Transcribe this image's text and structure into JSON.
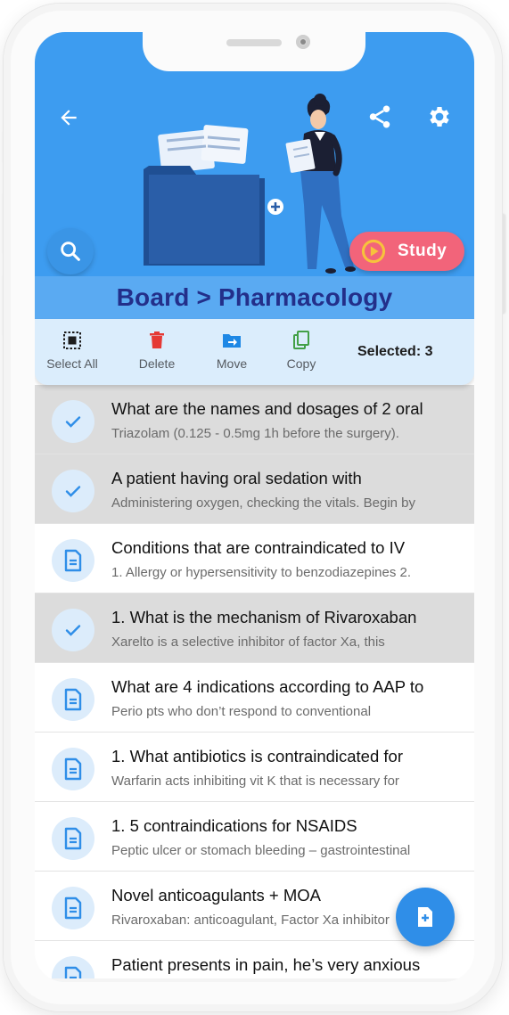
{
  "header": {
    "title": "Board > Pharmacology",
    "study_label": "Study"
  },
  "toolbar": {
    "select_all": "Select All",
    "delete": "Delete",
    "move": "Move",
    "copy": "Copy",
    "selected": "Selected: 3"
  },
  "cards": [
    {
      "question": "What are the names and dosages of 2 oral",
      "answer": "Triazolam (0.125 - 0.5mg 1h before the surgery).",
      "selected": true
    },
    {
      "question": "A patient having oral sedation with",
      "answer": "Administering oxygen, checking the vitals. Begin by",
      "selected": true
    },
    {
      "question": "Conditions that are contraindicated to IV",
      "answer": "1. Allergy or hypersensitivity to benzodiazepines 2.",
      "selected": false
    },
    {
      "question": "1. What is the mechanism of Rivaroxaban",
      "answer": "Xarelto is a selective inhibitor of factor Xa, this",
      "selected": true
    },
    {
      "question": "What are 4 indications according to AAP to",
      "answer": "Perio pts who don’t respond to conventional",
      "selected": false
    },
    {
      "question": "1. What antibiotics is contraindicated for",
      "answer": "Warfarin acts inhibiting vit K that is necessary for",
      "selected": false
    },
    {
      "question": "1. 5 contraindications for NSAIDS",
      "answer": "Peptic ulcer or stomach bleeding – gastrointestinal",
      "selected": false
    },
    {
      "question": "Novel anticoagulants + MOA",
      "answer": "Rivaroxaban: anticoagulant, Factor Xa inhibitor",
      "selected": false
    },
    {
      "question": "Patient presents in pain, he’s very anxious",
      "answer": "",
      "selected": false
    }
  ],
  "colors": {
    "header_blue": "#3d9cf0",
    "title_text": "#232f8a",
    "study_pink": "#f2647a",
    "delete_red": "#e53935",
    "move_blue": "#1e88e5",
    "copy_green": "#43a047",
    "selected_row": "#dcdcdc"
  },
  "icons": {
    "back": "arrow-left-icon",
    "share": "share-icon",
    "settings": "gear-icon",
    "search": "search-icon",
    "study": "play-circle-icon",
    "select_all": "select-all-icon",
    "delete": "trash-icon",
    "move": "folder-move-icon",
    "copy": "copy-icon",
    "check": "check-icon",
    "card": "document-icon",
    "add": "add-document-icon"
  }
}
